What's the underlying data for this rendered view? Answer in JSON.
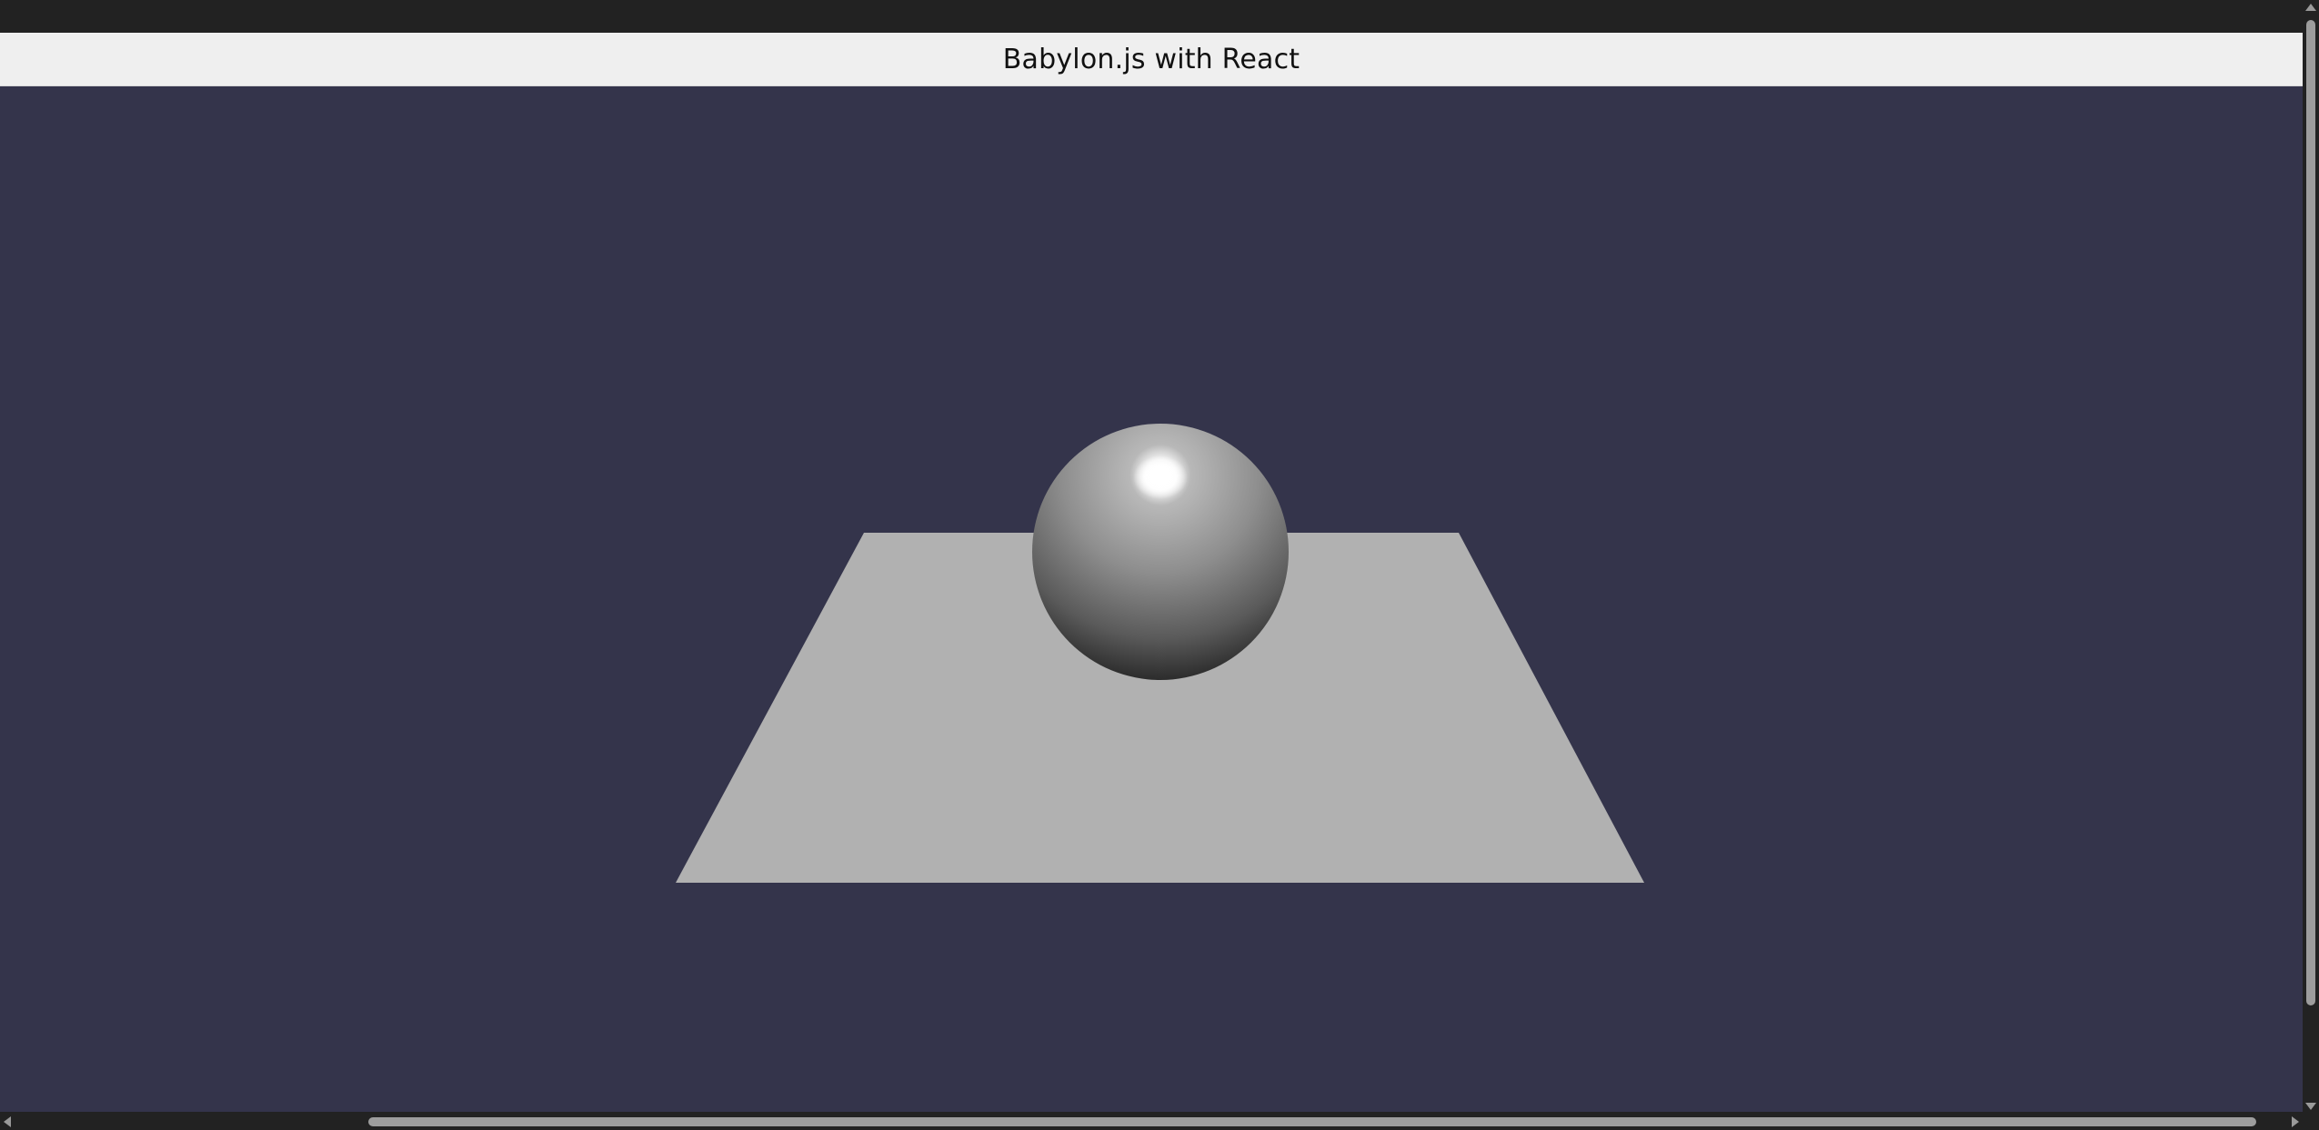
{
  "header": {
    "title": "Babylon.js with React"
  },
  "scene": {
    "background_color": "#34344b",
    "objects": [
      "sphere",
      "ground-plane"
    ],
    "ground_color": "#b1b1b1",
    "sphere_color": "#9a9a9a"
  },
  "icons": {
    "scroll_up": "chevron-up-icon",
    "scroll_down": "chevron-down-icon",
    "scroll_left": "chevron-left-icon",
    "scroll_right": "chevron-right-icon"
  }
}
